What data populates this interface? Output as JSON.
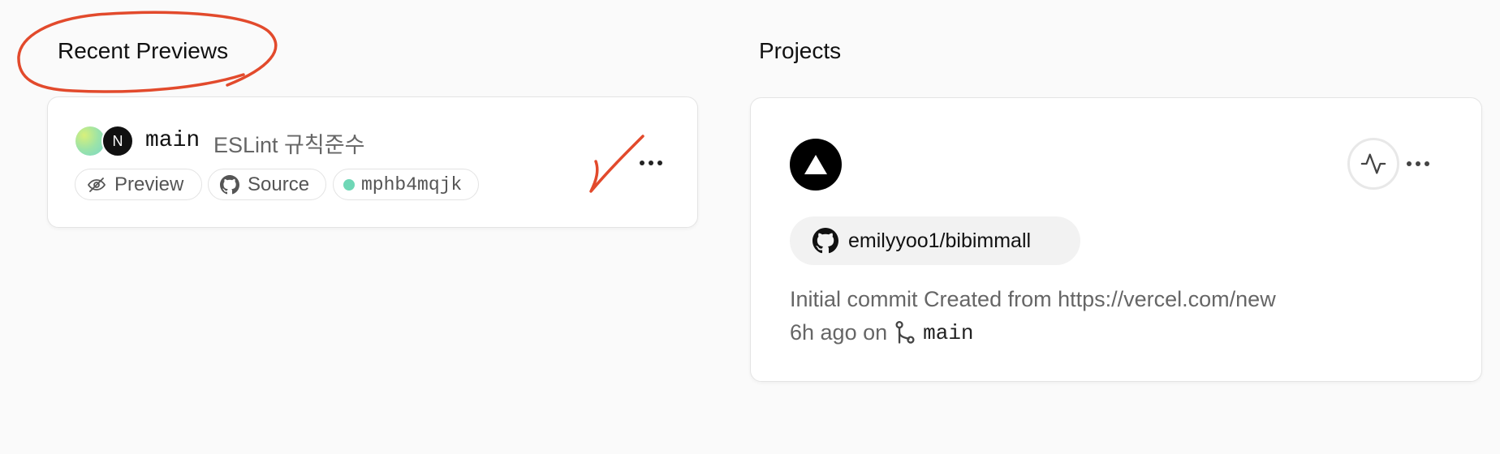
{
  "recent_previews": {
    "title": "Recent Previews",
    "items": [
      {
        "avatar_letter": "N",
        "branch": "main",
        "commit_message": "ESLint 규칙준수",
        "preview_label": "Preview",
        "source_label": "Source",
        "deployment_id": "mphb4mqjk",
        "status_color": "#6fd7b6"
      }
    ]
  },
  "projects": {
    "title": "Projects",
    "items": [
      {
        "repo": "emilyyoo1/bibimmall",
        "commit_message": "Initial commit Created from https://vercel.com/new",
        "time_ago": "6h ago on",
        "branch": "main"
      }
    ]
  },
  "annotations": {
    "color": "#e24a2c",
    "marks": [
      "circle-around-recent-previews-title",
      "checkmark-on-preview-card"
    ]
  },
  "icons": [
    "eye-icon",
    "github-icon",
    "status-dot-icon",
    "more-icon",
    "vercel-logo-icon",
    "activity-icon",
    "git-branch-icon"
  ]
}
